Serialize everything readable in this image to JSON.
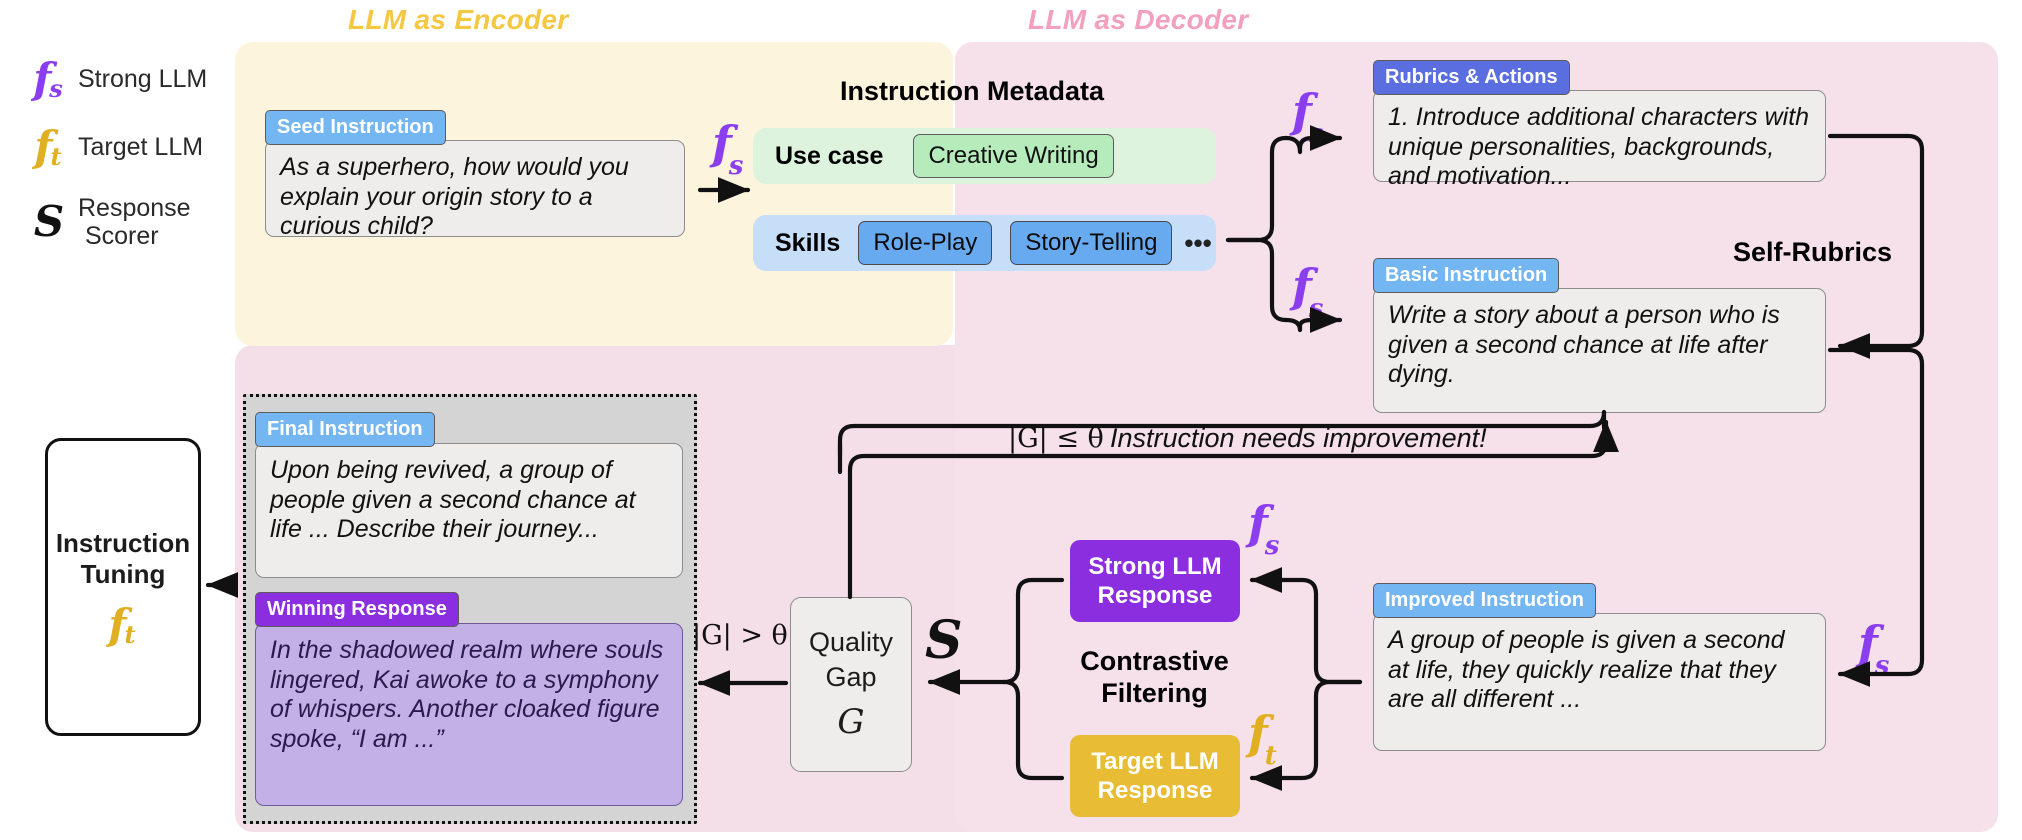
{
  "legend": {
    "items": [
      {
        "symbol": "f",
        "subscript": "s",
        "label": "Strong LLM",
        "color": "#8b3ef0"
      },
      {
        "symbol": "f",
        "subscript": "t",
        "label": "Target LLM",
        "color": "#e0b022"
      },
      {
        "symbol": "S",
        "subscript": "",
        "label": "Response Scorer",
        "color": "#111111"
      }
    ]
  },
  "panels": {
    "encoder_title": "LLM as Encoder",
    "decoder_title": "LLM as Decoder",
    "encoder_color": "#fdf4de",
    "decoder_color": "#f6e0ea",
    "encoder_title_color": "#f5c842",
    "decoder_title_color": "#f2a0bd"
  },
  "seed": {
    "tag": "Seed Instruction",
    "text": "As a superhero, how would you explain your origin story to a curious child?"
  },
  "metadata": {
    "title": "Instruction Metadata",
    "use_case_label": "Use case",
    "use_case_value": "Creative Writing",
    "skills_label": "Skills",
    "skills": [
      "Role-Play",
      "Story-Telling"
    ],
    "skills_more": "•••"
  },
  "rubrics": {
    "tag": "Rubrics & Actions",
    "text": "1. Introduce additional characters with unique personalities, backgrounds, and motivation...",
    "self_rubrics_label": "Self-Rubrics"
  },
  "basic": {
    "tag": "Basic Instruction",
    "text": "Write a story about a person who is given a second chance at life after dying."
  },
  "improved": {
    "tag": "Improved Instruction",
    "text": "A group of people is given a second at life, they quickly realize that they are all different ..."
  },
  "final": {
    "tag": "Final Instruction",
    "text": "Upon being revived, a group of people given a second chance at life ... Describe their journey..."
  },
  "winning": {
    "tag": "Winning Response",
    "text": "In the shadowed realm where souls lingered, Kai awoke to a symphony of whispers. Another cloaked figure spoke, “I am ...”"
  },
  "tuning": {
    "line1": "Instruction",
    "line2": "Tuning",
    "symbol": "f",
    "subscript": "t"
  },
  "quality_gap": {
    "line1": "Quality",
    "line2": "Gap",
    "symbol": "G"
  },
  "scorer_symbol": "S",
  "contrastive": {
    "label": "Contrastive Filtering",
    "strong_response": "Strong LLM Response",
    "target_response": "Target LLM Response",
    "strong_color": "#8b2ee0",
    "target_color": "#e8bc34"
  },
  "conditions": {
    "le_theta": "|G| ≤ θ",
    "gt_theta": "|G| > θ",
    "needs_improvement": "Instruction needs improvement!"
  },
  "f_symbols": {
    "strong": {
      "symbol": "f",
      "subscript": "s",
      "color": "#8b3ef0"
    },
    "target": {
      "symbol": "f",
      "subscript": "t",
      "color": "#e0b022"
    }
  }
}
